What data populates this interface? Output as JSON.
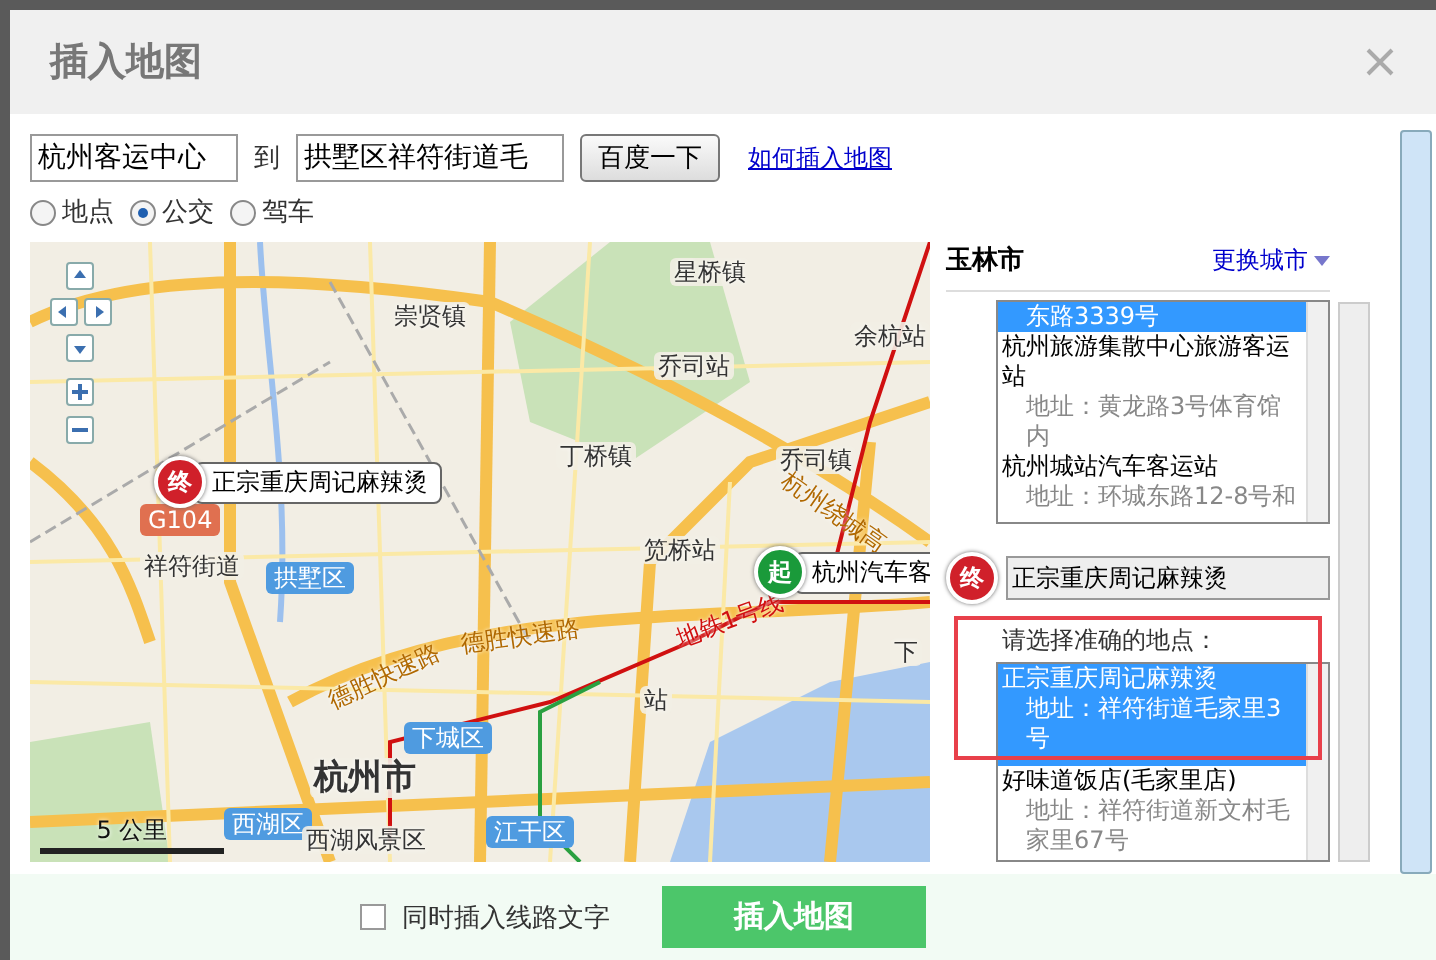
{
  "dialog": {
    "title": "插入地图"
  },
  "route": {
    "from_value": "杭州客运中心",
    "to_word": "到",
    "to_value": "拱墅区祥符街道毛",
    "search_button": "百度一下",
    "help_link": "如何插入地图"
  },
  "modes": [
    {
      "label": "地点",
      "selected": false
    },
    {
      "label": "公交",
      "selected": true
    },
    {
      "label": "驾车",
      "selected": false
    }
  ],
  "map": {
    "labels": [
      {
        "text": "星桥镇",
        "kind": "place"
      },
      {
        "text": "崇贤镇",
        "kind": "place"
      },
      {
        "text": "余杭站",
        "kind": "station"
      },
      {
        "text": "乔司站",
        "kind": "place"
      },
      {
        "text": "乔司镇",
        "kind": "place"
      },
      {
        "text": "丁桥镇",
        "kind": "place"
      },
      {
        "text": "笕桥站",
        "kind": "place"
      },
      {
        "text": "祥符街道",
        "kind": "place"
      },
      {
        "text": "拱墅区",
        "kind": "district"
      },
      {
        "text": "德胜快速路",
        "kind": "road"
      },
      {
        "text": "德胜快速路",
        "kind": "road"
      },
      {
        "text": "地铁1号线",
        "kind": "metro"
      },
      {
        "text": "杭州绕城高",
        "kind": "road"
      },
      {
        "text": "下",
        "kind": "place"
      },
      {
        "text": "站",
        "kind": "place"
      },
      {
        "text": "下城区",
        "kind": "district"
      },
      {
        "text": "杭州市",
        "kind": "city"
      },
      {
        "text": "西湖区",
        "kind": "district"
      },
      {
        "text": "西湖风景区",
        "kind": "place"
      },
      {
        "text": "江干区",
        "kind": "district"
      },
      {
        "text": "G104",
        "kind": "shield"
      }
    ],
    "end_marker": {
      "badge": "终",
      "label": "正宗重庆周记麻辣烫"
    },
    "start_marker": {
      "badge": "起",
      "label": "杭州汽车客"
    },
    "scale": "5 公里"
  },
  "panel": {
    "city": "玉林市",
    "change_city": "更换城市",
    "start_results": [
      {
        "address": "东路3339号",
        "selected": true
      },
      {
        "name": "杭州旅游集散中心旅游客运站",
        "address": "地址：黄龙路3号体育馆内",
        "selected": false
      },
      {
        "name": "杭州城站汽车客运站",
        "address": "地址：环城东路12-8号和",
        "selected": false
      }
    ],
    "end_badge": "终",
    "end_value": "正宗重庆周记麻辣烫",
    "prompt": "请选择准确的地点：",
    "end_results": [
      {
        "name": "正宗重庆周记麻辣烫",
        "address": "地址：祥符街道毛家里3号",
        "selected": true
      },
      {
        "name": "好味道饭店(毛家里店)",
        "address": "地址：祥符街道新文村毛家里67号",
        "selected": false
      }
    ]
  },
  "footer": {
    "option": {
      "label": "同时插入线路文字",
      "checked": false
    },
    "insert_button": "插入地图"
  }
}
